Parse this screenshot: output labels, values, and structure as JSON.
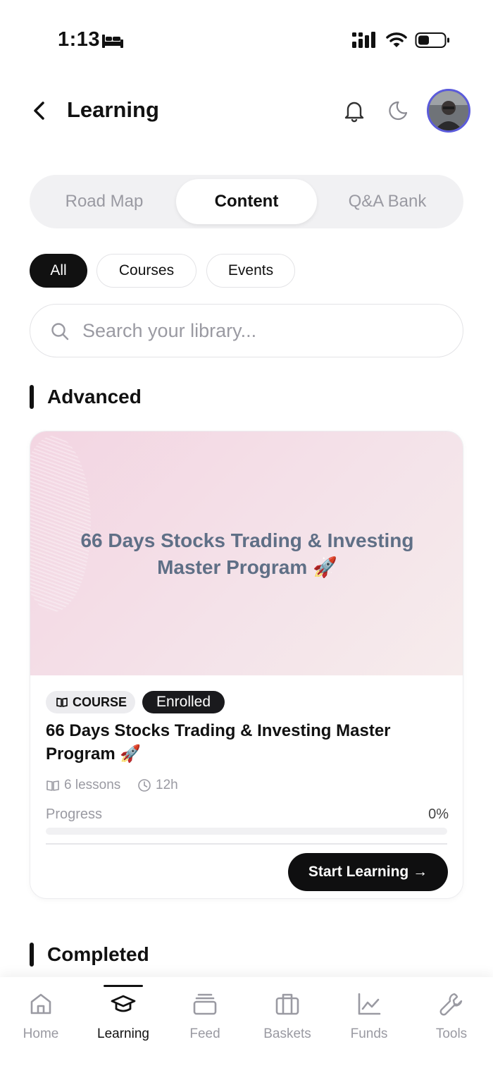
{
  "status_bar": {
    "time": "1:13"
  },
  "header": {
    "title": "Learning"
  },
  "tabs": [
    {
      "label": "Road Map",
      "active": false
    },
    {
      "label": "Content",
      "active": true
    },
    {
      "label": "Q&A Bank",
      "active": false
    }
  ],
  "filters": [
    {
      "label": "All",
      "active": true
    },
    {
      "label": "Courses",
      "active": false
    },
    {
      "label": "Events",
      "active": false
    }
  ],
  "search": {
    "placeholder": "Search your library...",
    "value": ""
  },
  "sections": [
    {
      "title": "Advanced",
      "card": {
        "banner_title": "66 Days Stocks Trading & Investing Master Program 🚀",
        "badge_type": "COURSE",
        "badge_status": "Enrolled",
        "title": "66 Days Stocks Trading & Investing Master Program 🚀",
        "lessons": "6 lessons",
        "duration": "12h",
        "progress_label": "Progress",
        "progress_value": "0%",
        "progress_fraction": 0,
        "cta_label": "Start Learning →"
      }
    },
    {
      "title": "Completed"
    }
  ],
  "bottom_nav": [
    {
      "label": "Home",
      "icon": "home-icon",
      "active": false
    },
    {
      "label": "Learning",
      "icon": "graduation-cap-icon",
      "active": true
    },
    {
      "label": "Feed",
      "icon": "feed-stack-icon",
      "active": false
    },
    {
      "label": "Baskets",
      "icon": "briefcase-icon",
      "active": false
    },
    {
      "label": "Funds",
      "icon": "line-chart-icon",
      "active": false
    },
    {
      "label": "Tools",
      "icon": "wrench-icon",
      "active": false
    }
  ],
  "colors": {
    "accent": "#111111",
    "avatar_ring": "#5b5bdb",
    "banner_title": "#5f6f86"
  }
}
